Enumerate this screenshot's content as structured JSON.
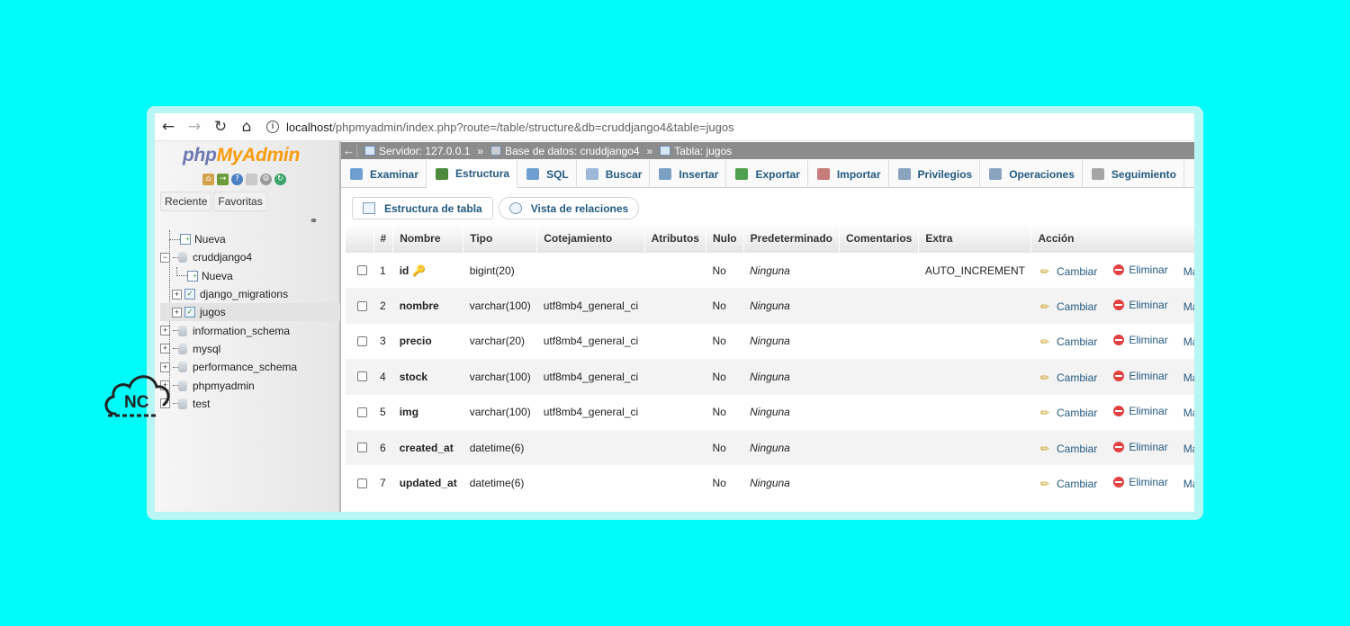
{
  "browser": {
    "url_host": "localhost",
    "url_path": "/phpmyadmin/index.php?route=/table/structure&db=cruddjango4&table=jugos"
  },
  "sidebar": {
    "logo_php": "php",
    "logo_myadmin": "MyAdmin",
    "recent_label": "Reciente",
    "favorites_label": "Favoritas",
    "tree": [
      {
        "label": "Nueva",
        "level": 0,
        "kind": "new"
      },
      {
        "label": "cruddjango4",
        "level": 0,
        "kind": "db",
        "expanded": true
      },
      {
        "label": "Nueva",
        "level": 1,
        "kind": "new"
      },
      {
        "label": "django_migrations",
        "level": 1,
        "kind": "table"
      },
      {
        "label": "jugos",
        "level": 1,
        "kind": "table",
        "active": true
      },
      {
        "label": "information_schema",
        "level": 0,
        "kind": "db"
      },
      {
        "label": "mysql",
        "level": 0,
        "kind": "db"
      },
      {
        "label": "performance_schema",
        "level": 0,
        "kind": "db"
      },
      {
        "label": "phpmyadmin",
        "level": 0,
        "kind": "db"
      },
      {
        "label": "test",
        "level": 0,
        "kind": "db"
      }
    ]
  },
  "breadcrumb": {
    "server": "Servidor: 127.0.0.1",
    "database": "Base de datos: cruddjango4",
    "table": "Tabla: jugos",
    "separator": "»"
  },
  "tabs": [
    {
      "label": "Examinar",
      "icon": "browse-icon",
      "color": "#6f9fd1"
    },
    {
      "label": "Estructura",
      "icon": "structure-icon",
      "color": "#4b8b3b",
      "active": true
    },
    {
      "label": "SQL",
      "icon": "sql-icon",
      "color": "#6f9fd1"
    },
    {
      "label": "Buscar",
      "icon": "search-icon",
      "color": "#9db8d6"
    },
    {
      "label": "Insertar",
      "icon": "insert-icon",
      "color": "#7aa0c4"
    },
    {
      "label": "Exportar",
      "icon": "export-icon",
      "color": "#4fa04f"
    },
    {
      "label": "Importar",
      "icon": "import-icon",
      "color": "#c77b7b"
    },
    {
      "label": "Privilegios",
      "icon": "privileges-icon",
      "color": "#8aa3bf"
    },
    {
      "label": "Operaciones",
      "icon": "wrench-icon",
      "color": "#8aa3bf"
    },
    {
      "label": "Seguimiento",
      "icon": "eye-icon",
      "color": "#a5a5a5"
    }
  ],
  "subtabs": {
    "table_structure": "Estructura de tabla",
    "relation_view": "Vista de relaciones"
  },
  "table": {
    "headers": [
      "#",
      "Nombre",
      "Tipo",
      "Cotejamiento",
      "Atributos",
      "Nulo",
      "Predeterminado",
      "Comentarios",
      "Extra",
      "Acción"
    ],
    "action_change": "Cambiar",
    "action_delete": "Eliminar",
    "action_more": "Más",
    "rows": [
      {
        "num": "1",
        "name": "id",
        "primary_key": true,
        "type": "bigint(20)",
        "collation": "",
        "attributes": "",
        "null": "No",
        "default": "Ninguna",
        "comments": "",
        "extra": "AUTO_INCREMENT"
      },
      {
        "num": "2",
        "name": "nombre",
        "type": "varchar(100)",
        "collation": "utf8mb4_general_ci",
        "attributes": "",
        "null": "No",
        "default": "Ninguna",
        "comments": "",
        "extra": ""
      },
      {
        "num": "3",
        "name": "precio",
        "type": "varchar(20)",
        "collation": "utf8mb4_general_ci",
        "attributes": "",
        "null": "No",
        "default": "Ninguna",
        "comments": "",
        "extra": ""
      },
      {
        "num": "4",
        "name": "stock",
        "type": "varchar(100)",
        "collation": "utf8mb4_general_ci",
        "attributes": "",
        "null": "No",
        "default": "Ninguna",
        "comments": "",
        "extra": ""
      },
      {
        "num": "5",
        "name": "img",
        "type": "varchar(100)",
        "collation": "utf8mb4_general_ci",
        "attributes": "",
        "null": "No",
        "default": "Ninguna",
        "comments": "",
        "extra": ""
      },
      {
        "num": "6",
        "name": "created_at",
        "type": "datetime(6)",
        "collation": "",
        "attributes": "",
        "null": "No",
        "default": "Ninguna",
        "comments": "",
        "extra": ""
      },
      {
        "num": "7",
        "name": "updated_at",
        "type": "datetime(6)",
        "collation": "",
        "attributes": "",
        "null": "No",
        "default": "Ninguna",
        "comments": "",
        "extra": ""
      }
    ]
  },
  "watermark": {
    "text": "NC"
  },
  "colors": {
    "background": "#00fbfb",
    "link": "#235a81",
    "breadcrumb_bg": "#8c8c8c",
    "logo_php": "#6c78af",
    "logo_myadmin": "#f89c0e"
  }
}
